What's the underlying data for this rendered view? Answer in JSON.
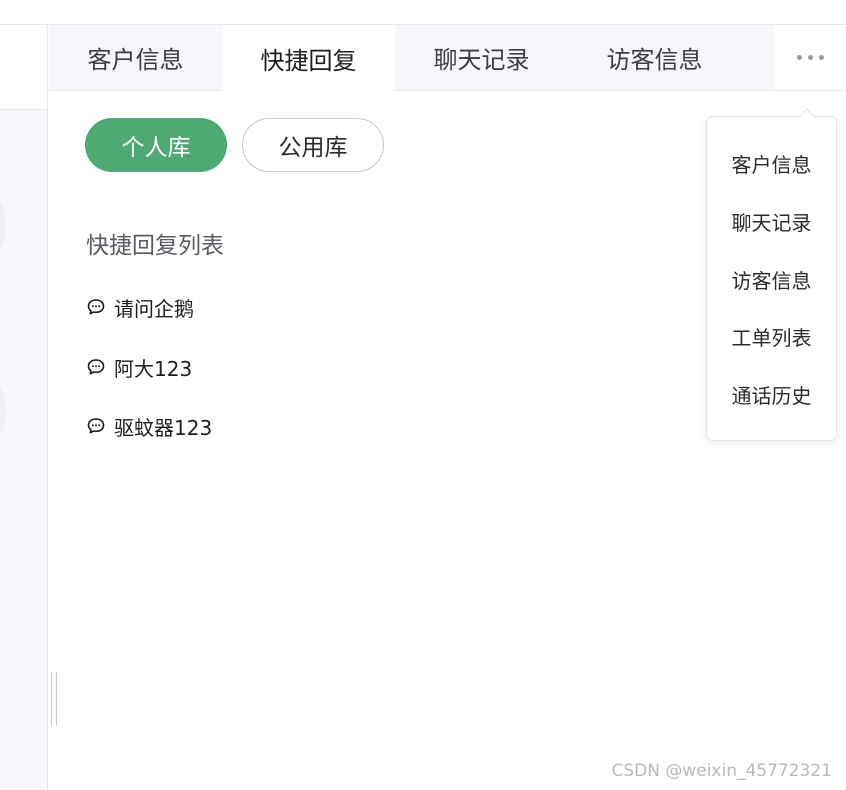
{
  "tabs": [
    {
      "label": "客户信息"
    },
    {
      "label": "快捷回复"
    },
    {
      "label": "聊天记录"
    },
    {
      "label": "访客信息"
    }
  ],
  "library_tabs": {
    "personal": "个人库",
    "public": "公用库"
  },
  "quick_reply": {
    "list_title": "快捷回复列表",
    "items": [
      {
        "text": "请问企鹅"
      },
      {
        "text": "阿大123"
      },
      {
        "text": "驱蚊器123"
      }
    ]
  },
  "more_menu": {
    "items": [
      {
        "label": "客户信息"
      },
      {
        "label": "聊天记录"
      },
      {
        "label": "访客信息"
      },
      {
        "label": "工单列表"
      },
      {
        "label": "通话历史"
      }
    ]
  },
  "watermark": "CSDN @weixin_45772321",
  "colors": {
    "accent": "#4eaa72",
    "tabbar_bg": "#f6f6fb"
  }
}
